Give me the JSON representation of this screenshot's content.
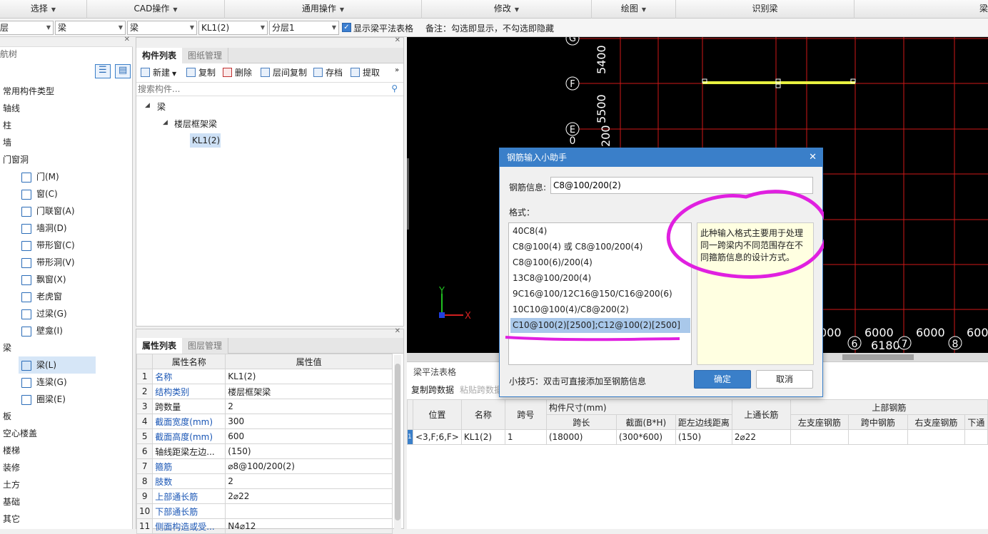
{
  "menubar": {
    "items": [
      "选择",
      "CAD操作",
      "通用操作",
      "修改",
      "绘图",
      "识别梁",
      "梁"
    ]
  },
  "filterbar": {
    "floor": "层",
    "type1": "梁",
    "type2": "梁",
    "component": "KL1(2)",
    "layer": "分层1",
    "show_label": "显示梁平法表格",
    "note": "备注：勾选即显示，不勾选即隐藏"
  },
  "leftnav": {
    "title": "航树",
    "items": [
      {
        "label": "常用构件类型",
        "level": 0
      },
      {
        "label": "轴线",
        "level": 0
      },
      {
        "label": "柱",
        "level": 0
      },
      {
        "label": "墙",
        "level": 0
      },
      {
        "label": "门窗洞",
        "level": 0
      },
      {
        "label": "门(M)",
        "level": 1,
        "icon": "door-icon"
      },
      {
        "label": "窗(C)",
        "level": 1,
        "icon": "window-icon"
      },
      {
        "label": "门联窗(A)",
        "level": 1,
        "icon": "door-window-icon"
      },
      {
        "label": "墙洞(D)",
        "level": 1,
        "icon": "wall-hole-icon"
      },
      {
        "label": "带形窗(C)",
        "level": 1,
        "icon": "strip-window-icon"
      },
      {
        "label": "带形洞(V)",
        "level": 1,
        "icon": "strip-hole-icon"
      },
      {
        "label": "飘窗(X)",
        "level": 1,
        "icon": "bay-window-icon"
      },
      {
        "label": "老虎窗",
        "level": 1,
        "icon": "dormer-icon"
      },
      {
        "label": "过梁(G)",
        "level": 1,
        "icon": "lintel-icon"
      },
      {
        "label": "壁龛(I)",
        "level": 1,
        "icon": "niche-icon"
      },
      {
        "label": "梁",
        "level": 0
      },
      {
        "label": "梁(L)",
        "level": 1,
        "icon": "beam-icon",
        "selected": true
      },
      {
        "label": "连梁(G)",
        "level": 1,
        "icon": "coupling-beam-icon"
      },
      {
        "label": "圈梁(E)",
        "level": 1,
        "icon": "ring-beam-icon"
      },
      {
        "label": "板",
        "level": 0
      },
      {
        "label": "空心楼盖",
        "level": 0
      },
      {
        "label": "楼梯",
        "level": 0
      },
      {
        "label": "装修",
        "level": 0
      },
      {
        "label": "土方",
        "level": 0
      },
      {
        "label": "基础",
        "level": 0
      },
      {
        "label": "其它",
        "level": 0
      }
    ]
  },
  "complist": {
    "tab_active": "构件列表",
    "tab_inactive": "图纸管理",
    "tools": [
      "新建",
      "复制",
      "删除",
      "层间复制",
      "存档",
      "提取"
    ],
    "search_placeholder": "搜索构件...",
    "tree": {
      "root": "梁",
      "group": "楼层框架梁",
      "leaf": "KL1(2)"
    }
  },
  "proplist": {
    "tab_active": "属性列表",
    "tab_inactive": "图层管理",
    "col_name": "属性名称",
    "col_value": "属性值",
    "rows": [
      {
        "no": "1",
        "name": "名称",
        "value": "KL1(2)",
        "blue": true
      },
      {
        "no": "2",
        "name": "结构类别",
        "value": "楼层框架梁",
        "blue": true
      },
      {
        "no": "3",
        "name": "跨数量",
        "value": "2",
        "blue": false
      },
      {
        "no": "4",
        "name": "截面宽度(mm)",
        "value": "300",
        "blue": true
      },
      {
        "no": "5",
        "name": "截面高度(mm)",
        "value": "600",
        "blue": true
      },
      {
        "no": "6",
        "name": "轴线距梁左边...",
        "value": "(150)",
        "blue": false
      },
      {
        "no": "7",
        "name": "箍筋",
        "value": "⌀8@100/200(2)",
        "blue": true
      },
      {
        "no": "8",
        "name": "肢数",
        "value": "2",
        "blue": true
      },
      {
        "no": "9",
        "name": "上部通长筋",
        "value": "2⌀22",
        "blue": true
      },
      {
        "no": "10",
        "name": "下部通长筋",
        "value": "",
        "blue": true
      },
      {
        "no": "11",
        "name": "侧面构造或受...",
        "value": "N4⌀12",
        "blue": true
      }
    ]
  },
  "canvas": {
    "axis_labels": [
      "G",
      "F",
      "E",
      "6",
      "7",
      "8"
    ],
    "dims_vertical": [
      "5400",
      "5500",
      "200",
      "0"
    ],
    "dims_horizontal": [
      "000",
      "6000",
      "6000",
      "600"
    ],
    "total": "61800",
    "axis_y": "Y",
    "axis_x": "X",
    "colors": {
      "grid": "#d01818",
      "beam": "#e8f040",
      "bg": "#000000"
    }
  },
  "beamtable": {
    "title": "梁平法表格",
    "btn_copy": "复制跨数据",
    "btn_paste": "粘贴跨数据",
    "headers": {
      "pos": "位置",
      "name": "名称",
      "span_no": "跨号",
      "size_group": "构件尺寸(mm)",
      "span_len": "跨长",
      "section": "截面(B*H)",
      "edge_dist": "距左边线距离",
      "top_through": "上通长筋",
      "top_rebar": "上部钢筋",
      "left_seat": "左支座钢筋",
      "mid": "跨中钢筋",
      "right_seat": "右支座钢筋",
      "bottom": "下通"
    },
    "row": {
      "idx": "1",
      "pos": "<3,F;6,F>",
      "name": "KL1(2)",
      "span_no": "1",
      "span_len": "(18000)",
      "section": "(300*600)",
      "edge_dist": "(150)",
      "top_through": "2⌀22"
    }
  },
  "dialog": {
    "title": "钢筋输入小助手",
    "info_label": "钢筋信息:",
    "info_value": "C8@100/200(2)",
    "format_label": "格式：",
    "formats": [
      "40C8(4)",
      "C8@100(4) 或 C8@100/200(4)",
      "C8@100(6)/200(4)",
      "13C8@100/200(4)",
      "9C16@100/12C16@150/C16@200(6)",
      "10C10@100(4)/C8@200(2)",
      "C10@100(2)[2500];C12@100(2)[2500]"
    ],
    "selected_index": 6,
    "description": "此种输入格式主要用于处理同一跨梁内不同范围存在不同箍筋信息的设计方式。",
    "tip": "小技巧：双击可直接添加至钢筋信息",
    "ok": "确定",
    "cancel": "取消",
    "accent": "#3a7fc9",
    "highlight": "#e020e0"
  }
}
